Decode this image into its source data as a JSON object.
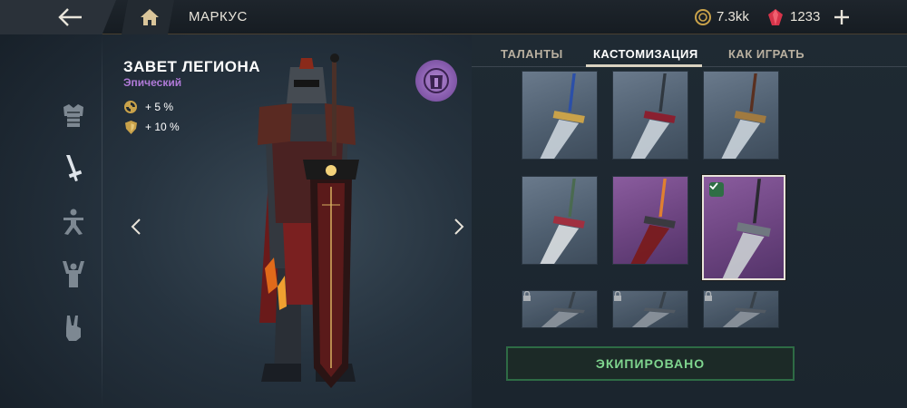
{
  "topbar": {
    "title": "МАРКУС",
    "coins": "7.3kk",
    "gems": "1233",
    "icons": [
      "back-arrow-icon",
      "home-icon",
      "coin-icon",
      "gem-icon",
      "plus-icon"
    ]
  },
  "item": {
    "name": "ЗАВЕТ ЛЕГИОНА",
    "rarity": "Эпический",
    "rarity_color": "#b07ad8",
    "stats": [
      {
        "icon": "swirl-icon",
        "value": "+ 5 %"
      },
      {
        "icon": "shield-icon",
        "value": "+ 10 %"
      }
    ]
  },
  "left_nav": [
    "armor-icon",
    "sword-icon",
    "fighting-stance-icon",
    "victory-pose-icon",
    "peace-hand-icon"
  ],
  "tabs": [
    {
      "label": "ТАЛАНТЫ",
      "active": false
    },
    {
      "label": "КАСТОМИЗАЦИЯ",
      "active": true
    },
    {
      "label": "КАК ИГРАТЬ",
      "active": false
    }
  ],
  "skins": [
    {
      "bg": "blue",
      "blade": "#c8d0d8",
      "guard": "#c9a24a",
      "grip": "#2b4fa8",
      "selected": false,
      "locked": false
    },
    {
      "bg": "blue",
      "blade": "#c8d0d8",
      "guard": "#8a2030",
      "grip": "#303840",
      "selected": false,
      "locked": false
    },
    {
      "bg": "blue",
      "blade": "#c8d0d8",
      "guard": "#a07a40",
      "grip": "#5a3020",
      "selected": false,
      "locked": false
    },
    {
      "bg": "blue",
      "blade": "#d8dce0",
      "guard": "#a03040",
      "grip": "#4a6a50",
      "selected": false,
      "locked": false
    },
    {
      "bg": "purple",
      "blade": "#7a1a1a",
      "guard": "#3a3a40",
      "grip": "#e08030",
      "selected": false,
      "locked": false
    },
    {
      "bg": "purple",
      "blade": "#c8ccd0",
      "guard": "#707880",
      "grip": "#2a2a30",
      "selected": true,
      "locked": false
    },
    {
      "bg": "blue",
      "locked": true
    },
    {
      "bg": "blue",
      "locked": true
    },
    {
      "bg": "blue",
      "locked": true
    }
  ],
  "equip_button": "ЭКИПИРОВАНО",
  "colors": {
    "accent_green": "#7fd58f",
    "gem_red": "#d6344a",
    "coin_gold": "#c9a24a"
  }
}
